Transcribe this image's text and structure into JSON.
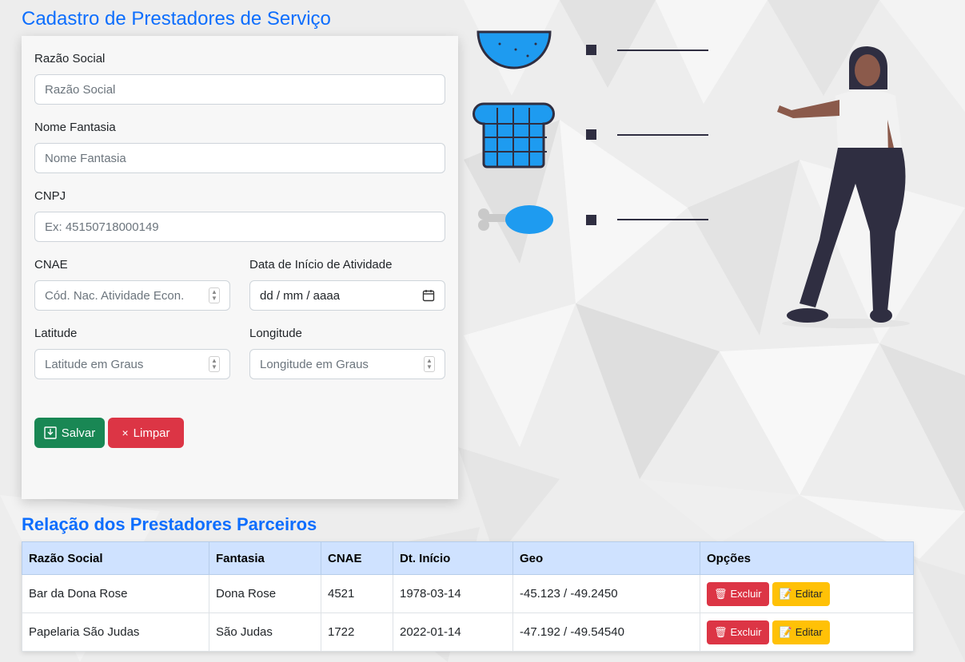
{
  "page": {
    "title": "Cadastro de Prestadores de Serviço",
    "list_title": "Relação dos Prestadores Parceiros"
  },
  "form": {
    "razao_social": {
      "label": "Razão Social",
      "placeholder": "Razão Social"
    },
    "nome_fantasia": {
      "label": "Nome Fantasia",
      "placeholder": "Nome Fantasia"
    },
    "cnpj": {
      "label": "CNPJ",
      "placeholder": "Ex: 45150718000149"
    },
    "cnae": {
      "label": "CNAE",
      "placeholder": "Cód. Nac. Atividade Econ."
    },
    "data_inicio": {
      "label": "Data de Início de Atividade",
      "value": "dd / mm / aaaa"
    },
    "latitude": {
      "label": "Latitude",
      "placeholder": "Latitude em Graus"
    },
    "longitude": {
      "label": "Longitude",
      "placeholder": "Longitude em Graus"
    },
    "save_label": "Salvar",
    "clear_label": "Limpar",
    "clear_glyph": "×"
  },
  "table": {
    "headers": [
      "Razão Social",
      "Fantasia",
      "CNAE",
      "Dt. Início",
      "Geo",
      "Opções"
    ],
    "rows": [
      {
        "razao": "Bar da Dona Rose",
        "fantasia": "Dona Rose",
        "cnae": "4521",
        "inicio": "1978-03-14",
        "geo": "-45.123 / -49.2450"
      },
      {
        "razao": "Papelaria São Judas",
        "fantasia": "São Judas",
        "cnae": "1722",
        "inicio": "2022-01-14",
        "geo": "-47.192 / -49.54540"
      }
    ],
    "delete_label": "Excluir",
    "edit_label": "Editar",
    "delete_glyph": "🗑",
    "edit_glyph": "📝"
  },
  "colors": {
    "primary": "#0d6efd",
    "save": "#198754",
    "danger": "#dc3545",
    "warning": "#ffc107",
    "table_header": "#cfe2ff",
    "illustration_accent": "#1e9bf0"
  },
  "icons": [
    "calendar-icon",
    "save-icon",
    "close-icon",
    "trash-icon",
    "edit-icon",
    "spinner-arrows-icon"
  ]
}
